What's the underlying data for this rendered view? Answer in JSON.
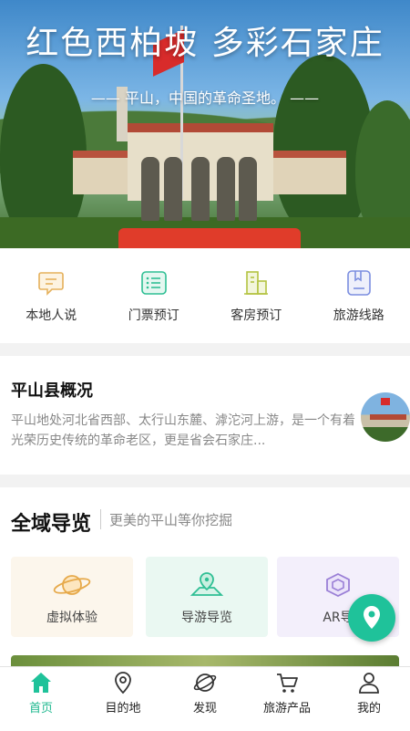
{
  "banner": {
    "title": "红色西柏坡  多彩石家庄",
    "subtitle": "—— 平山，中国的革命圣地。 ——"
  },
  "quick_links": [
    {
      "label": "本地人说",
      "icon": "chat-bubble-icon",
      "color": "#e5b15c"
    },
    {
      "label": "门票预订",
      "icon": "ticket-list-icon",
      "color": "#2fbf94"
    },
    {
      "label": "客房预订",
      "icon": "hotel-building-icon",
      "color": "#b4c341"
    },
    {
      "label": "旅游线路",
      "icon": "route-book-icon",
      "color": "#7b8ee0"
    }
  ],
  "overview": {
    "title": "平山县概况",
    "description": "平山地处河北省西部、太行山东麓、滹沱河上游，是一个有着光荣历史传统的革命老区，更是省会石家庄..."
  },
  "guide": {
    "title": "全域导览",
    "subtitle": "更美的平山等你挖掘",
    "cards": [
      {
        "label": "虚拟体验",
        "icon": "planet-icon",
        "bg": "#fcf6ec",
        "color": "#e6a94a"
      },
      {
        "label": "导游导览",
        "icon": "map-pin-icon",
        "bg": "#eaf8f2",
        "color": "#2fbf94"
      },
      {
        "label": "AR导",
        "icon": "ar-cube-icon",
        "bg": "#f3effb",
        "color": "#9a7fd6"
      }
    ]
  },
  "tabbar": [
    {
      "label": "首页",
      "icon": "home-icon",
      "active": true
    },
    {
      "label": "目的地",
      "icon": "location-pin-icon",
      "active": false
    },
    {
      "label": "发现",
      "icon": "discover-planet-icon",
      "active": false
    },
    {
      "label": "旅游产品",
      "icon": "shopping-cart-icon",
      "active": false
    },
    {
      "label": "我的",
      "icon": "user-icon",
      "active": false
    }
  ],
  "colors": {
    "accent": "#1fc29a"
  }
}
